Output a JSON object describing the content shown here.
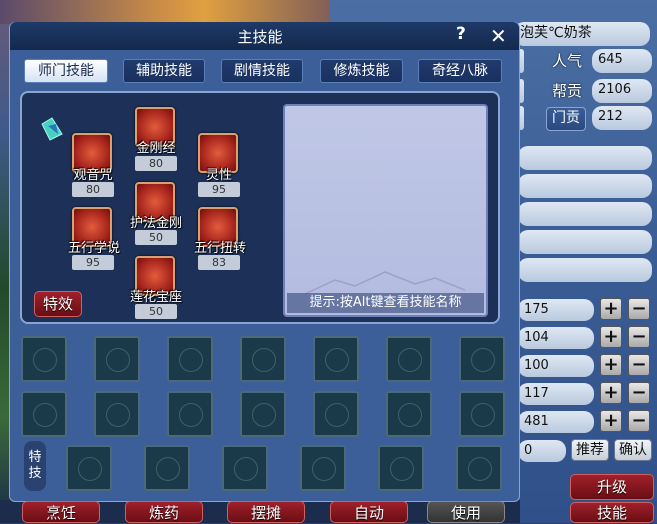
{
  "dialog": {
    "title": "主技能",
    "help": "?",
    "close": "✕"
  },
  "tabs": [
    {
      "label": "师门技能",
      "active": true
    },
    {
      "label": "辅助技能",
      "active": false
    },
    {
      "label": "剧情技能",
      "active": false
    },
    {
      "label": "修炼技能",
      "active": false
    },
    {
      "label": "奇经八脉",
      "active": false
    }
  ],
  "skills": [
    {
      "name": "金刚经",
      "level": "80"
    },
    {
      "name": "观音咒",
      "level": "80"
    },
    {
      "name": "灵性",
      "level": "95"
    },
    {
      "name": "护法金刚",
      "level": "50"
    },
    {
      "name": "五行学说",
      "level": "95"
    },
    {
      "name": "五行扭转",
      "level": "83"
    },
    {
      "name": "莲花宝座",
      "level": "50"
    }
  ],
  "effects_button": "特效",
  "description_hint": "提示:按Alt键查看技能名称",
  "special_label": "特技",
  "bottom_buttons": [
    "烹饪",
    "炼药",
    "摆摊",
    "自动",
    "使用"
  ],
  "right_panel": {
    "name_partial": "泡芙℃奶茶",
    "popularity_label": "人气",
    "popularity_value": "645",
    "guild_contrib_label": "帮贡",
    "guild_contrib_value": "2106",
    "sect_contrib_label": "门贡",
    "sect_contrib_value": "212",
    "attributes": [
      "175",
      "104",
      "100",
      "117",
      "481"
    ],
    "remaining_partial": "0",
    "recommend_button": "推荐",
    "confirm_button": "确认",
    "upgrade_button": "升级",
    "skills_button": "技能"
  }
}
